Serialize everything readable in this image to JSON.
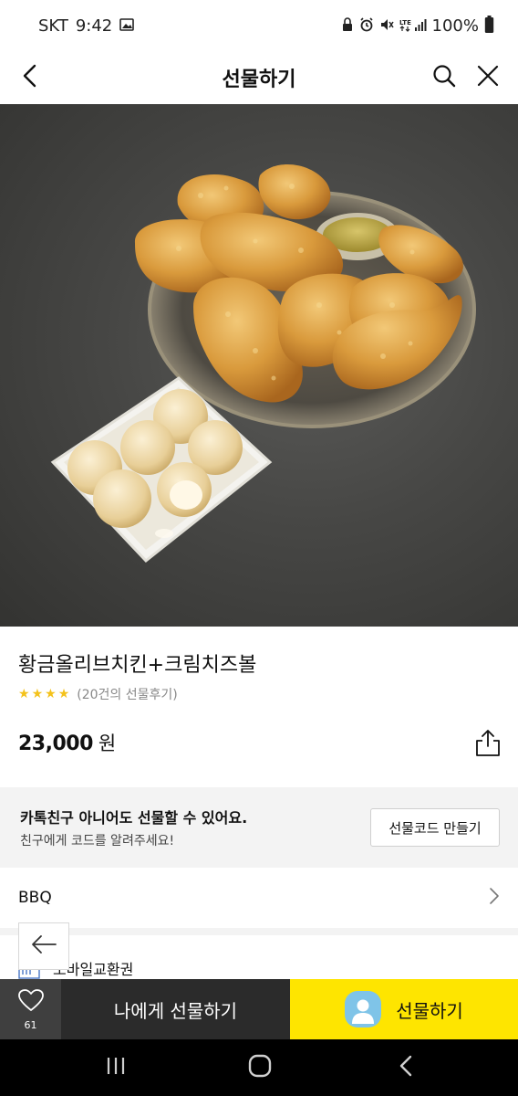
{
  "status_bar": {
    "carrier": "SKT",
    "time": "9:42",
    "battery": "100%",
    "icons": [
      "image-icon",
      "lock-icon",
      "alarm-icon",
      "mute-icon",
      "lte-signal-icon",
      "battery-icon"
    ]
  },
  "header": {
    "title": "선물하기",
    "back_icon": "back-arrow-icon",
    "search_icon": "search-icon",
    "close_icon": "close-icon"
  },
  "hero": {
    "image_subject": "fried chicken platter with cheese balls"
  },
  "product": {
    "name": "황금올리브치킨+크림치즈볼",
    "rating": 4,
    "rating_max": 5,
    "review_text": "(20건의 선물후기)",
    "price": "23,000",
    "price_unit": "원",
    "share_icon": "share-icon"
  },
  "code_banner": {
    "main_text": "카톡친구 아니어도 선물할 수 있어요.",
    "sub_text": "친구에게 코드를 알려주세요!",
    "button_label": "선물코드 만들기"
  },
  "brand": {
    "name": "BBQ"
  },
  "voucher": {
    "label": "모바일교환권"
  },
  "bottom_bar": {
    "wish_count": "61",
    "self_gift_label": "나에게 선물하기",
    "gift_label": "선물하기"
  },
  "colors": {
    "accent_yellow": "#fee500",
    "star": "#f4c21b",
    "dark_button": "#2b2b2b"
  }
}
